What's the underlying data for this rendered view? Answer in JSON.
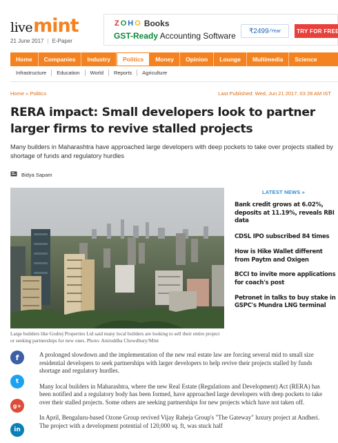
{
  "masthead": {
    "logo_live": "live",
    "logo_mint": "mint",
    "date": "21 June 2017",
    "epaper": "E-Paper"
  },
  "ad": {
    "brand_letters": [
      "Z",
      "O",
      "H",
      "O"
    ],
    "brand_colors": [
      "#e42527",
      "#089949",
      "#226db4",
      "#f9b21d"
    ],
    "product": "Books",
    "tagline_green": "GST-Ready",
    "tagline_rest": " Accounting Software",
    "price": "₹2499",
    "price_unit": "/Year",
    "cta": "TRY FOR FREE"
  },
  "nav_primary": [
    {
      "label": "Home",
      "active": false
    },
    {
      "label": "Companies",
      "active": false
    },
    {
      "label": "Industry",
      "active": false
    },
    {
      "label": "Politics",
      "active": true
    },
    {
      "label": "Money",
      "active": false
    },
    {
      "label": "Opinion",
      "active": false
    },
    {
      "label": "Lounge",
      "active": false
    },
    {
      "label": "Multimedia",
      "active": false
    },
    {
      "label": "Science",
      "active": false
    }
  ],
  "nav_secondary": [
    "Infrastructure",
    "Education",
    "World",
    "Reports",
    "Agriculture"
  ],
  "breadcrumb": "Home » Politics",
  "published": "Last Published: Wed, Jun 21 2017. 03 28 AM IST",
  "headline": "RERA impact: Small developers look to partner larger firms to revive stalled projects",
  "dek": "Many builders in Maharashtra have approached large developers with deep pockets to take over projects stalled by shortage of funds and regulatory hurdles",
  "byline": "Bidya Sapam",
  "caption": "Large builders like Godrej Properties Ltd said many local builders are looking to sell their entire project or seeking partnerships for new ones. Photo: Aniruddha Chowdhury/Mint",
  "latest": {
    "heading": "LATEST NEWS »",
    "stories": [
      "Bank credit grows at 6.02%, deposits at 11.19%, reveals RBI data",
      "CDSL IPO subscribed 84 times",
      "How is Hike Wallet different from Paytm and Oxigen",
      "BCCI to invite more applications for coach's post",
      "Petronet in talks to buy stake in GSPC's Mundra LNG terminal"
    ]
  },
  "social": {
    "facebook": "f",
    "twitter": "t",
    "googleplus": "g+",
    "linkedin": "in"
  },
  "article": [
    "A prolonged slowdown and the implementation of the new real estate law are forcing several mid to small size residential developers to seek partnerships with larger developers to help revive their projects stalled by funds shortage and regulatory hurdles.",
    "Many local builders in Maharashtra, where the new Real Estate (Regulations and Development) Act (RERA) has been notified and a regulatory body has been formed, have approached large developers with deep pockets to take over their stalled projects. Some others are seeking partnerships for new projects which have not taken off.",
    "In April, Bengaluru-based Ozone Group revived Vijay Raheja Group's \"The Gateway\" luxury project at Andheri. The project with a development potential of 120,000 sq. ft, was stuck half"
  ],
  "colors": {
    "brand_orange": "#f58220",
    "link_blue": "#2f8bd1"
  }
}
